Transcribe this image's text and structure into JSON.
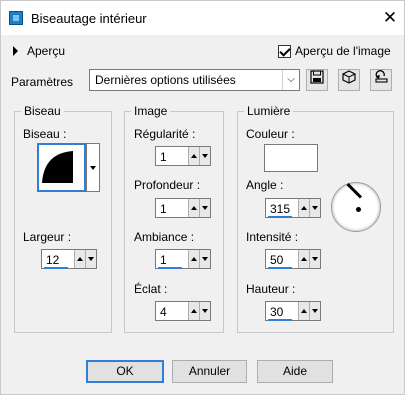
{
  "window": {
    "title": "Biseautage intérieur",
    "close_glyph": "✕"
  },
  "preview": {
    "toggle_label": "Aperçu",
    "checkbox_label": "Aperçu de l'image",
    "checkbox_checked": true
  },
  "params": {
    "label": "Paramètres",
    "preset_value": "Dernières options utilisées",
    "icons": [
      "save-icon",
      "dice-icon",
      "reset-icon"
    ]
  },
  "groups": {
    "biseau": {
      "title": "Biseau",
      "bevel_label": "Biseau :",
      "width_label": "Largeur :",
      "width_value": "12"
    },
    "image": {
      "title": "Image",
      "regularite_label": "Régularité :",
      "regularite_value": "1",
      "profondeur_label": "Profondeur :",
      "profondeur_value": "1",
      "ambiance_label": "Ambiance :",
      "ambiance_value": "1",
      "eclat_label": "Éclat :",
      "eclat_value": "4"
    },
    "lumiere": {
      "title": "Lumière",
      "couleur_label": "Couleur :",
      "couleur_value": "#ffffff",
      "angle_label": "Angle :",
      "angle_value": "315",
      "intensite_label": "Intensité :",
      "intensite_value": "50",
      "hauteur_label": "Hauteur :",
      "hauteur_value": "30"
    }
  },
  "buttons": {
    "ok": "OK",
    "cancel": "Annuler",
    "help": "Aide"
  }
}
